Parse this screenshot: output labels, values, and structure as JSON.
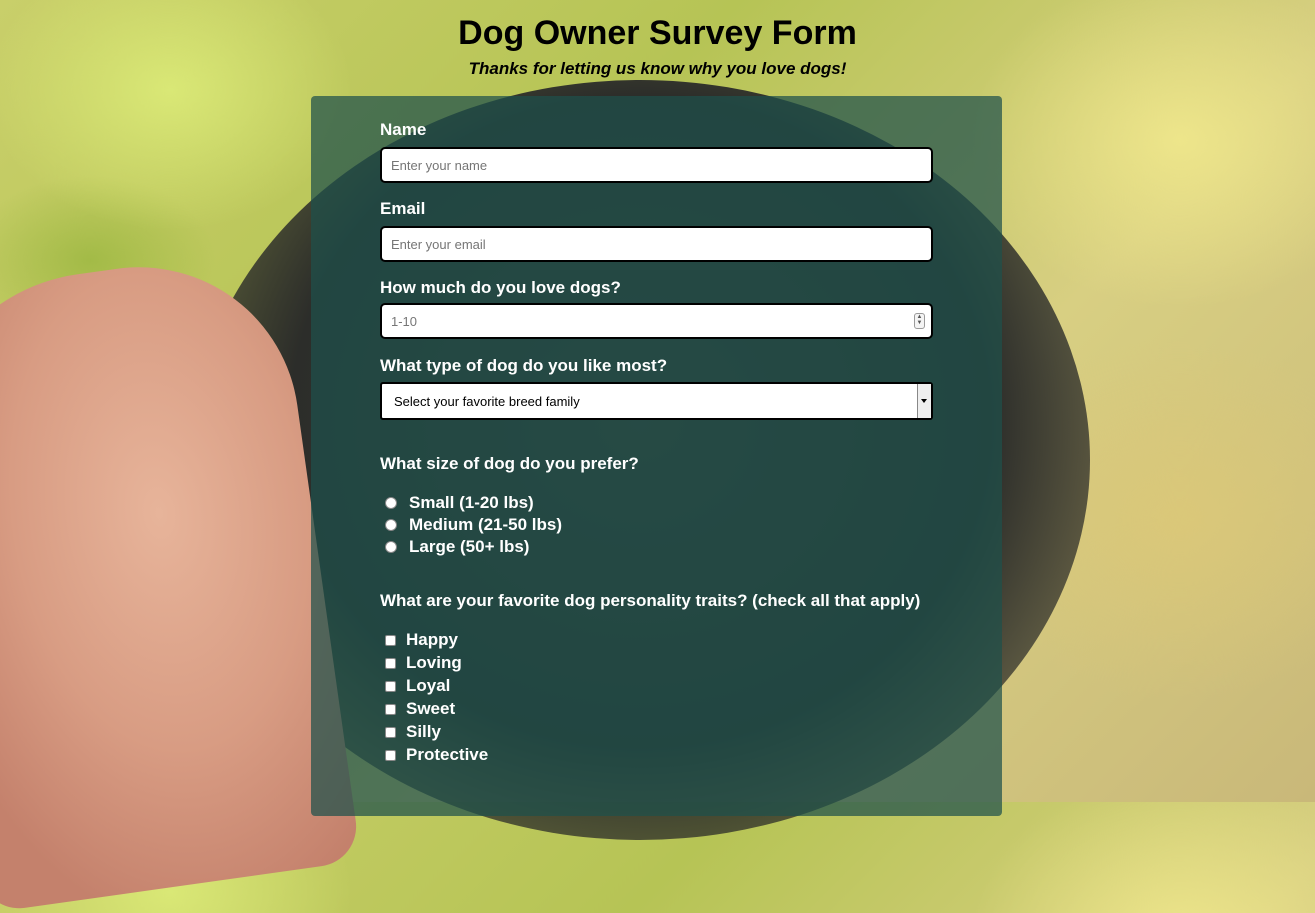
{
  "header": {
    "title": "Dog Owner Survey Form",
    "description": "Thanks for letting us know why you love dogs!"
  },
  "form": {
    "name": {
      "label": "Name",
      "placeholder": "Enter your name"
    },
    "email": {
      "label": "Email",
      "placeholder": "Enter your email"
    },
    "love": {
      "label": "How much do you love dogs?",
      "placeholder": "1-10"
    },
    "breed": {
      "label": "What type of dog do you like most?",
      "selected": "Select your favorite breed family"
    },
    "size": {
      "label": "What size of dog do you prefer?",
      "options": [
        "Small (1-20 lbs)",
        "Medium (21-50 lbs)",
        "Large (50+ lbs)"
      ]
    },
    "traits": {
      "label": "What are your favorite dog personality traits? (check all that apply)",
      "options": [
        "Happy",
        "Loving",
        "Loyal",
        "Sweet",
        "Silly",
        "Protective"
      ]
    }
  },
  "colors": {
    "panel": "#1e504b",
    "text": "#ffffff"
  }
}
